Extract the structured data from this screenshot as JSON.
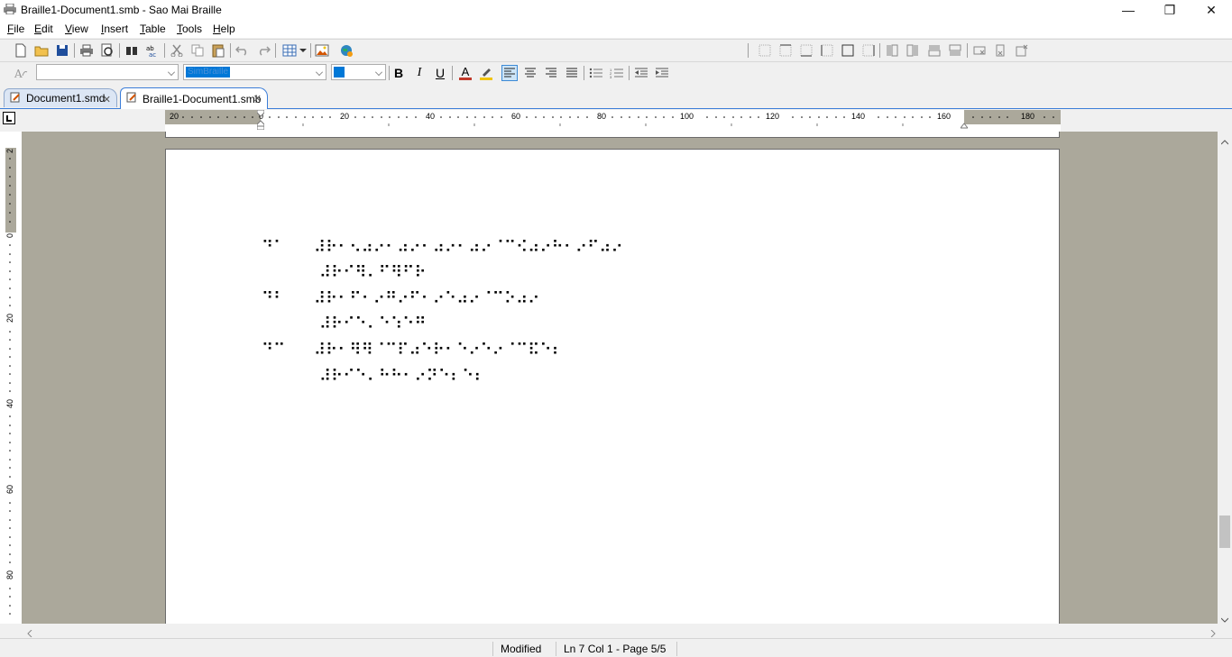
{
  "window": {
    "title": "Braille1-Document1.smb - Sao Mai Braille",
    "minimize_glyph": "—",
    "maximize_glyph": "❐",
    "close_glyph": "✕"
  },
  "menu": [
    {
      "label": "File",
      "key": "F",
      "rest": "ile"
    },
    {
      "label": "Edit",
      "key": "E",
      "rest": "dit"
    },
    {
      "label": "View",
      "key": "V",
      "rest": "iew"
    },
    {
      "label": "Insert",
      "key": "I",
      "rest": "nsert"
    },
    {
      "label": "Table",
      "key": "T",
      "rest": "able"
    },
    {
      "label": "Tools",
      "key": "T",
      "rest": "ools"
    },
    {
      "label": "Help",
      "key": "H",
      "rest": "elp"
    }
  ],
  "format_toolbar": {
    "style_value": "",
    "font_value": "SimBraille",
    "size_value": "",
    "bold": "B",
    "italic": "I",
    "underline": "U",
    "font_color_glyph": "A",
    "font_color": "#c0392b",
    "highlight_color": "#f1c40f"
  },
  "tabs": [
    {
      "label": "Document1.smd",
      "active": false
    },
    {
      "label": "Braille1-Document1.smb",
      "active": true
    }
  ],
  "ruler_h": {
    "labels": [
      "20",
      "0",
      "20",
      "40",
      "60",
      "80",
      "100",
      "120",
      "140",
      "160",
      "180"
    ]
  },
  "ruler_v": {
    "labels": [
      "2",
      "0",
      "20",
      "40",
      "60",
      "80"
    ]
  },
  "document": {
    "lines": [
      {
        "num": "⠙⠁",
        "text": "⠼⠗⠂⠢⠴⠔⠂⠴⠔⠂⠴⠔⠂⠴⠔⠈⠉⠪⠴⠔⠓⠂⠔⠋⠴⠔"
      },
      {
        "num": "",
        "text": "⠼⠗⠊⠻⠄⠋⠻⠋⠗"
      },
      {
        "num": "⠙⠃",
        "text": "⠼⠗⠂⠋⠂⠔⠛⠔⠋⠂⠔⠑⠴⠔⠈⠉⠕⠴⠔"
      },
      {
        "num": "",
        "text": "⠼⠗⠊⠑⠄⠑⠱⠑⠛"
      },
      {
        "num": "⠙⠉",
        "text": "⠼⠗⠂⠻⠻⠈⠉⠏⠴⠑⠗⠂⠑⠔⠑⠔⠈⠉⠯⠑⠆"
      },
      {
        "num": "",
        "text": "⠼⠗⠊⠑⠄⠓⠓⠂⠔⠝⠑⠆⠑⠆"
      }
    ]
  },
  "status": {
    "modified": "Modified",
    "position": "Ln 7 Col 1 - Page 5/5"
  }
}
